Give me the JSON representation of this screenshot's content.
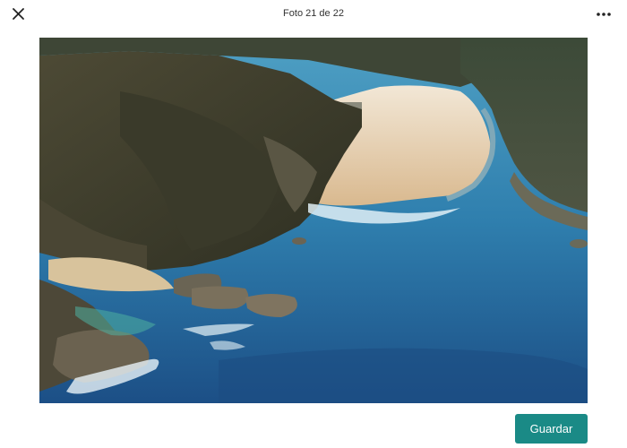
{
  "header": {
    "title": "Foto 21 de 22",
    "close_icon": "close-icon",
    "more_icon": "more-options-icon"
  },
  "photo": {
    "subject": "aerial-coastal-beach-photo"
  },
  "actions": {
    "save_label": "Guardar",
    "save_color": "#1a8a86"
  }
}
